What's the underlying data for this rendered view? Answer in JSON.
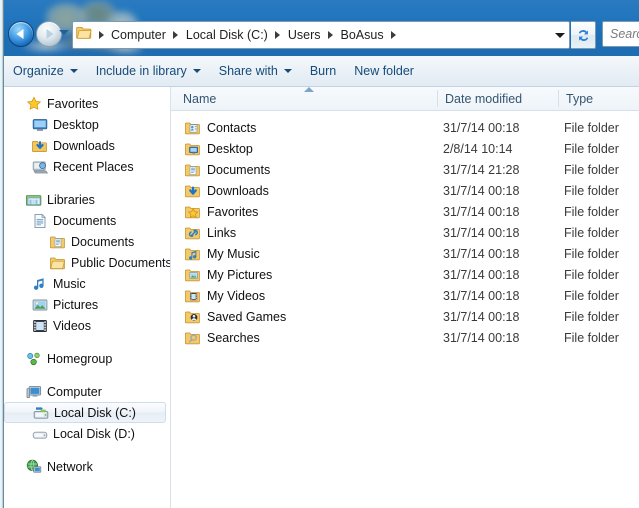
{
  "window": {
    "chrome_color": "#1f6fb5",
    "title_redacted": true
  },
  "navigation": {
    "back_label": "Back",
    "forward_label": "Forward",
    "recent_pages_label": "Recent pages",
    "refresh_label": "Refresh",
    "address_dropdown_label": "Previous locations"
  },
  "address_bar": {
    "crumbs": [
      "Computer",
      "Local Disk (C:)",
      "Users",
      "BoAsus"
    ],
    "folder_icon": "folder-icon"
  },
  "search": {
    "placeholder": "Search BoAsus",
    "visible_text": "Searc"
  },
  "toolbar": {
    "items": [
      {
        "label": "Organize",
        "has_caret": true
      },
      {
        "label": "Include in library",
        "has_caret": true
      },
      {
        "label": "Share with",
        "has_caret": true
      },
      {
        "label": "Burn",
        "has_caret": false
      },
      {
        "label": "New folder",
        "has_caret": false
      }
    ]
  },
  "sidebar": {
    "groups": [
      {
        "header": {
          "label": "Favorites",
          "icon": "star-icon",
          "indent": 0
        },
        "items": [
          {
            "label": "Desktop",
            "icon": "desktop-icon",
            "indent": 1
          },
          {
            "label": "Downloads",
            "icon": "downloads-icon",
            "indent": 1
          },
          {
            "label": "Recent Places",
            "icon": "recent-places-icon",
            "indent": 1
          }
        ]
      },
      {
        "header": {
          "label": "Libraries",
          "icon": "libraries-icon",
          "indent": 0
        },
        "items": [
          {
            "label": "Documents",
            "icon": "library-documents-icon",
            "indent": 1
          },
          {
            "label": "Documents",
            "icon": "folder-documents-icon",
            "indent": 2
          },
          {
            "label": "Public Documents",
            "icon": "folder-icon",
            "indent": 2
          },
          {
            "label": "Music",
            "icon": "music-icon",
            "indent": 1
          },
          {
            "label": "Pictures",
            "icon": "pictures-icon",
            "indent": 1
          },
          {
            "label": "Videos",
            "icon": "videos-icon",
            "indent": 1
          }
        ]
      },
      {
        "header": {
          "label": "Homegroup",
          "icon": "homegroup-icon",
          "indent": 0
        },
        "items": []
      },
      {
        "header": {
          "label": "Computer",
          "icon": "computer-icon",
          "indent": 0
        },
        "items": [
          {
            "label": "Local Disk (C:)",
            "icon": "system-drive-icon",
            "indent": 1,
            "selected": true
          },
          {
            "label": "Local Disk (D:)",
            "icon": "drive-icon",
            "indent": 1
          }
        ]
      },
      {
        "header": {
          "label": "Network",
          "icon": "network-icon",
          "indent": 0
        },
        "items": []
      }
    ]
  },
  "file_list": {
    "columns": [
      {
        "label": "Name",
        "sorted": "asc"
      },
      {
        "label": "Date modified",
        "sorted": null
      },
      {
        "label": "Type",
        "sorted": null
      }
    ],
    "rows": [
      {
        "name": "Contacts",
        "date": "31/7/14 00:18",
        "type": "File folder",
        "icon": "folder-contacts-icon"
      },
      {
        "name": "Desktop",
        "date": "2/8/14 10:14",
        "type": "File folder",
        "icon": "folder-desktop-icon"
      },
      {
        "name": "Documents",
        "date": "31/7/14 21:28",
        "type": "File folder",
        "icon": "folder-documents-icon"
      },
      {
        "name": "Downloads",
        "date": "31/7/14 00:18",
        "type": "File folder",
        "icon": "folder-downloads-icon"
      },
      {
        "name": "Favorites",
        "date": "31/7/14 00:18",
        "type": "File folder",
        "icon": "folder-favorites-icon"
      },
      {
        "name": "Links",
        "date": "31/7/14 00:18",
        "type": "File folder",
        "icon": "folder-links-icon"
      },
      {
        "name": "My Music",
        "date": "31/7/14 00:18",
        "type": "File folder",
        "icon": "folder-music-icon"
      },
      {
        "name": "My Pictures",
        "date": "31/7/14 00:18",
        "type": "File folder",
        "icon": "folder-pictures-icon"
      },
      {
        "name": "My Videos",
        "date": "31/7/14 00:18",
        "type": "File folder",
        "icon": "folder-videos-icon"
      },
      {
        "name": "Saved Games",
        "date": "31/7/14 00:18",
        "type": "File folder",
        "icon": "folder-savedgames-icon"
      },
      {
        "name": "Searches",
        "date": "31/7/14 00:18",
        "type": "File folder",
        "icon": "folder-searches-icon"
      }
    ]
  }
}
